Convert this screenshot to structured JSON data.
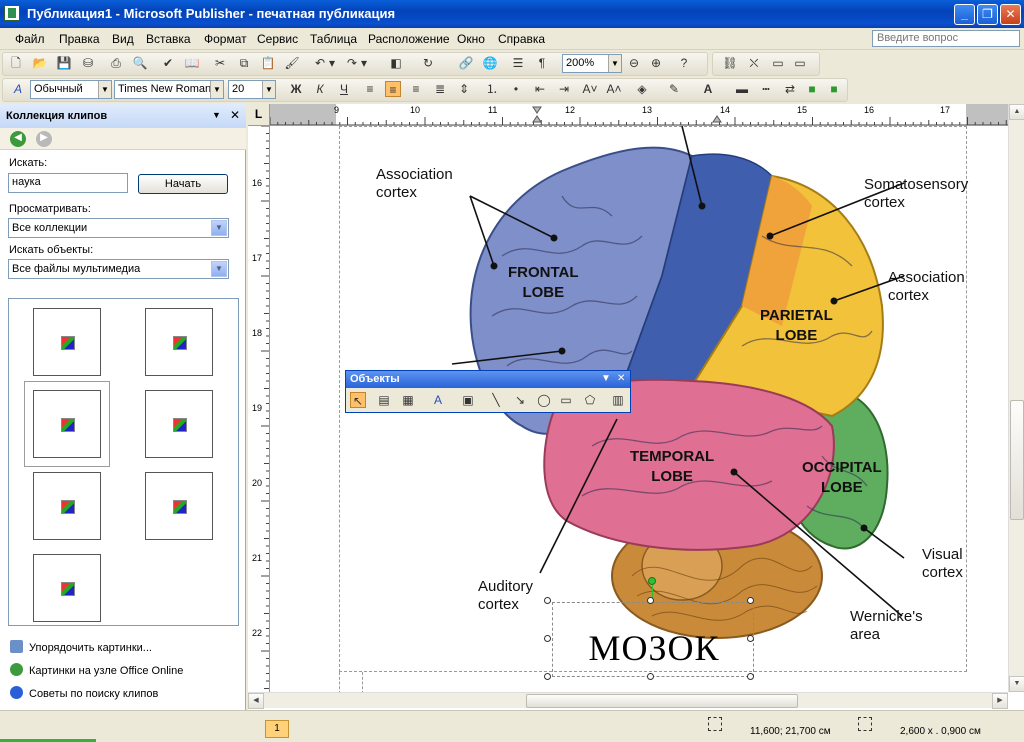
{
  "window": {
    "title": "Публикация1 - Microsoft Publisher - печатная публикация"
  },
  "menu": {
    "items": [
      "Файл",
      "Правка",
      "Вид",
      "Вставка",
      "Формат",
      "Сервис",
      "Таблица",
      "Расположение",
      "Окно",
      "Справка"
    ],
    "ask_placeholder": "Введите вопрос"
  },
  "toolbar": {
    "zoom": "200%",
    "style": "Обычный",
    "font": "Times New Roman",
    "size": "20",
    "bold": "Ж",
    "italic": "К",
    "underline": "Ч"
  },
  "task_pane": {
    "title": "Коллекция клипов",
    "search_label": "Искать:",
    "search_value": "наука",
    "go_button": "Начать",
    "browse_label": "Просматривать:",
    "browse_value": "Все коллекции",
    "objects_label": "Искать объекты:",
    "objects_value": "Все файлы мультимедиа",
    "links": [
      "Упорядочить картинки...",
      "Картинки на узле Office Online",
      "Советы по поиску клипов"
    ]
  },
  "ruler": {
    "h_numbers": [
      "9",
      "10",
      "11",
      "12",
      "13",
      "14",
      "15",
      "16",
      "17"
    ],
    "v_numbers": [
      "16",
      "17",
      "18",
      "19",
      "20",
      "21",
      "22"
    ]
  },
  "brain_image": {
    "labels": {
      "association_top": "Association\ncortex",
      "somatosensory": "Somatosensory\ncortex",
      "association_right": "Association\ncortex",
      "visual": "Visual\ncortex",
      "wernicke": "Wernicke's\narea",
      "auditory": "Auditory\ncortex"
    },
    "lobes": {
      "frontal": "FRONTAL\nLOBE",
      "parietal": "PARIETAL\nLOBE",
      "temporal": "TEMPORAL\nLOBE",
      "occipital": "OCCIPITAL\nLOBE"
    },
    "colors": {
      "frontal": "#7f8fc9",
      "motor": "#3f5fae",
      "parietal": "#f2c23a",
      "temporal": "#df6f93",
      "occipital": "#5fae5f",
      "cerebellum": "#c98a3a"
    }
  },
  "textbox": {
    "text": "МОЗОК"
  },
  "objects_toolbar": {
    "title": "Объекты"
  },
  "status": {
    "page": "1",
    "position": "11,600; 21,700 см",
    "size": "2,600 х . 0,900 см"
  }
}
